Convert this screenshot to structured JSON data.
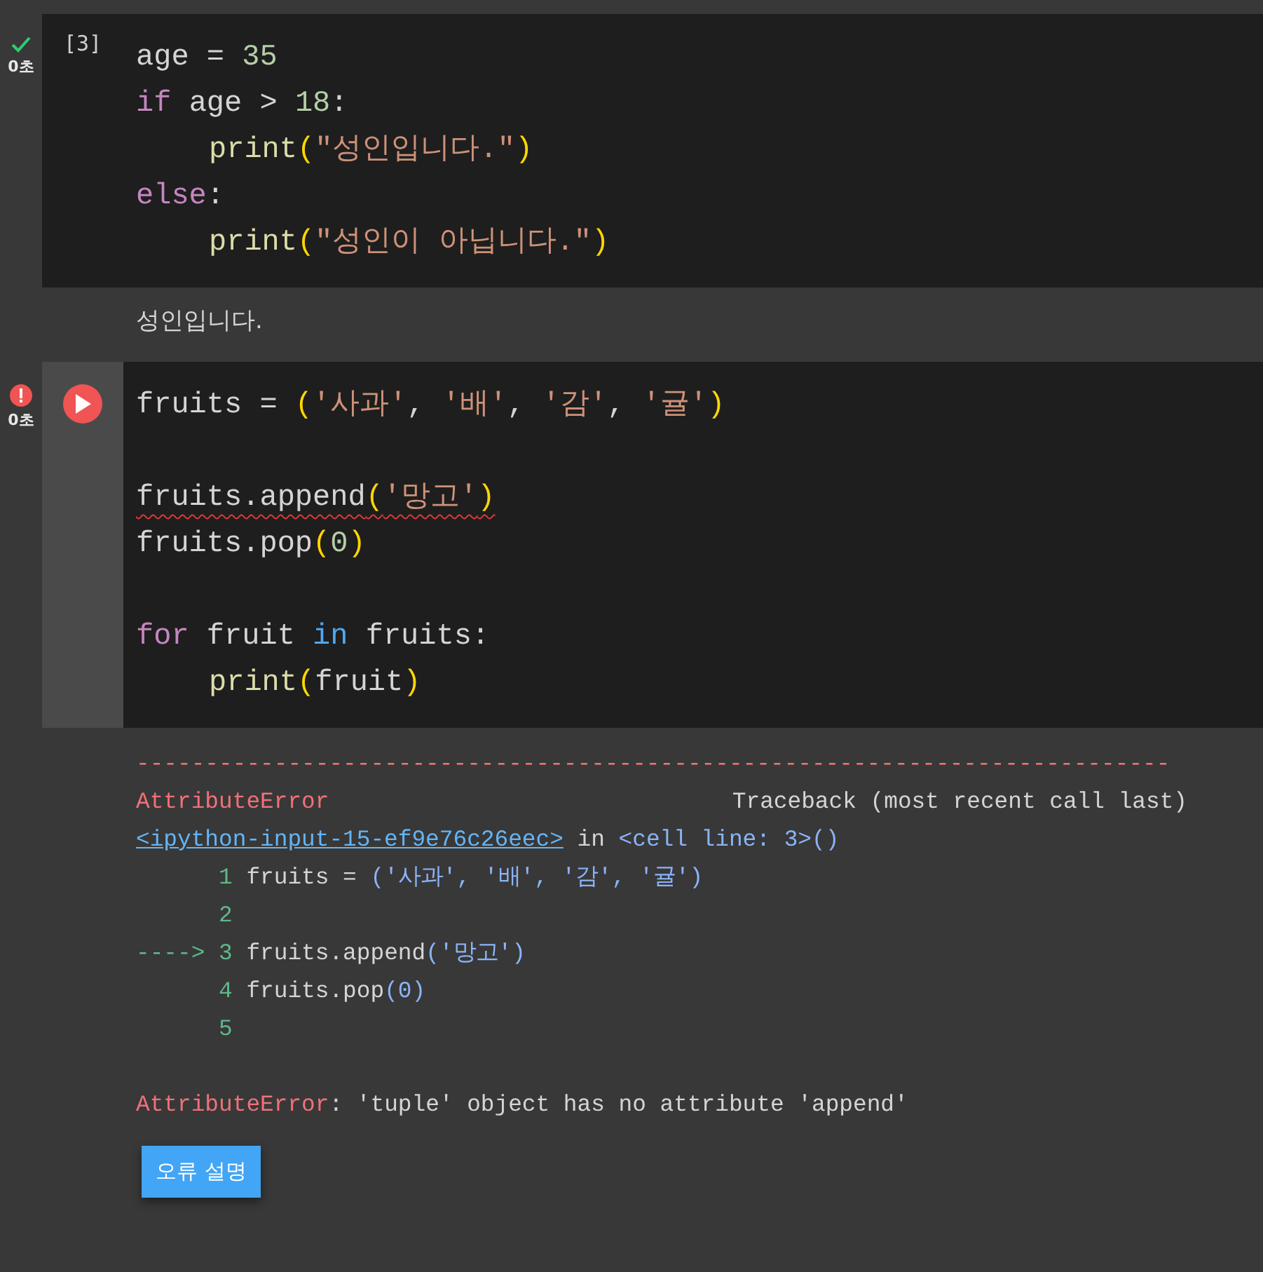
{
  "cells": [
    {
      "kind": "success",
      "time": "0초",
      "execution_count": "[3]",
      "code": [
        {
          "kind": "code",
          "tokens": [
            {
              "text": "age",
              "kind": "var"
            },
            {
              "text": " = ",
              "kind": "op"
            },
            {
              "text": "35",
              "kind": "num"
            }
          ]
        },
        {
          "kind": "code",
          "tokens": [
            {
              "text": "if",
              "kind": "kw"
            },
            {
              "text": " age > ",
              "kind": "var"
            },
            {
              "text": "18",
              "kind": "num"
            },
            {
              "text": ":",
              "kind": "op"
            }
          ]
        },
        {
          "kind": "code",
          "indented": true,
          "tokens": [
            {
              "text": "print",
              "kind": "fn"
            },
            {
              "text": "(",
              "kind": "paren"
            },
            {
              "text": "\"성인입니다.\"",
              "kind": "str"
            },
            {
              "text": ")",
              "kind": "paren"
            }
          ]
        },
        {
          "kind": "code",
          "tokens": [
            {
              "text": "else",
              "kind": "kw"
            },
            {
              "text": ":",
              "kind": "op"
            }
          ]
        },
        {
          "kind": "code",
          "indented": true,
          "tokens": [
            {
              "text": "print",
              "kind": "fn"
            },
            {
              "text": "(",
              "kind": "paren"
            },
            {
              "text": "\"성인이 아닙니다.\"",
              "kind": "str"
            },
            {
              "text": ")",
              "kind": "paren"
            }
          ]
        }
      ],
      "output": {
        "kind": "text",
        "lines": [
          "성인입니다."
        ]
      }
    },
    {
      "kind": "error",
      "time": "0초",
      "run_button": true,
      "code": [
        {
          "kind": "code",
          "tokens": [
            {
              "text": "fruits = ",
              "kind": "var"
            },
            {
              "text": "(",
              "kind": "paren"
            },
            {
              "text": "'사과'",
              "kind": "str"
            },
            {
              "text": ", ",
              "kind": "op"
            },
            {
              "text": "'배'",
              "kind": "str"
            },
            {
              "text": ", ",
              "kind": "op"
            },
            {
              "text": "'감'",
              "kind": "str"
            },
            {
              "text": ", ",
              "kind": "op"
            },
            {
              "text": "'귤'",
              "kind": "str"
            },
            {
              "text": ")",
              "kind": "paren"
            }
          ]
        },
        {
          "kind": "blank"
        },
        {
          "kind": "code",
          "error_underline": true,
          "tokens": [
            {
              "text": "fruits.append",
              "kind": "var"
            },
            {
              "text": "(",
              "kind": "paren"
            },
            {
              "text": "'망고'",
              "kind": "str"
            },
            {
              "text": ")",
              "kind": "paren"
            }
          ]
        },
        {
          "kind": "code",
          "tokens": [
            {
              "text": "fruits.pop",
              "kind": "var"
            },
            {
              "text": "(",
              "kind": "paren"
            },
            {
              "text": "0",
              "kind": "num"
            },
            {
              "text": ")",
              "kind": "paren"
            }
          ]
        },
        {
          "kind": "blank"
        },
        {
          "kind": "code",
          "tokens": [
            {
              "text": "for",
              "kind": "kw"
            },
            {
              "text": " fruit ",
              "kind": "var"
            },
            {
              "text": "in",
              "kind": "in"
            },
            {
              "text": " fruits:",
              "kind": "var"
            }
          ]
        },
        {
          "kind": "code",
          "indented": true,
          "tokens": [
            {
              "text": "print",
              "kind": "fn"
            },
            {
              "text": "(",
              "kind": "paren"
            },
            {
              "text": "fruit",
              "kind": "var"
            },
            {
              "text": ")",
              "kind": "paren"
            }
          ]
        }
      ],
      "output": {
        "kind": "traceback",
        "rule": "---------------------------------------------------------------------------",
        "lines": [
          {
            "kind": "text",
            "tokens": [
              {
                "text": "AttributeError",
                "kind": "error"
              }
            ],
            "right_tokens": [
              {
                "text": "Traceback (most recent call last)",
                "kind": "plain"
              }
            ]
          },
          {
            "kind": "text",
            "tokens": [
              {
                "text": "<ipython-input-15-ef9e76c26eec>",
                "kind": "link"
              },
              {
                "text": " in ",
                "kind": "plain"
              },
              {
                "text": "<cell line: 3>()",
                "kind": "paren"
              }
            ]
          },
          {
            "kind": "text",
            "tokens": [
              {
                "text": "      1 ",
                "kind": "lineno"
              },
              {
                "text": "fruits = ",
                "kind": "plain"
              },
              {
                "text": "('사과', '배', '감', '귤')",
                "kind": "paren"
              }
            ]
          },
          {
            "kind": "text",
            "tokens": [
              {
                "text": "      2",
                "kind": "lineno"
              }
            ]
          },
          {
            "kind": "text",
            "tokens": [
              {
                "text": "----> 3 ",
                "kind": "lineno"
              },
              {
                "text": "fruits.append",
                "kind": "plain"
              },
              {
                "text": "('망고')",
                "kind": "paren"
              }
            ]
          },
          {
            "kind": "text",
            "tokens": [
              {
                "text": "      4 ",
                "kind": "lineno"
              },
              {
                "text": "fruits.pop",
                "kind": "plain"
              },
              {
                "text": "(0)",
                "kind": "paren"
              }
            ]
          },
          {
            "kind": "text",
            "tokens": [
              {
                "text": "      5",
                "kind": "lineno"
              }
            ]
          },
          {
            "kind": "blank"
          },
          {
            "kind": "text",
            "tokens": [
              {
                "text": "AttributeError",
                "kind": "error"
              },
              {
                "text": ": 'tuple' object has no attribute 'append'",
                "kind": "plain"
              }
            ]
          }
        ],
        "button": "오류 설명"
      }
    }
  ]
}
